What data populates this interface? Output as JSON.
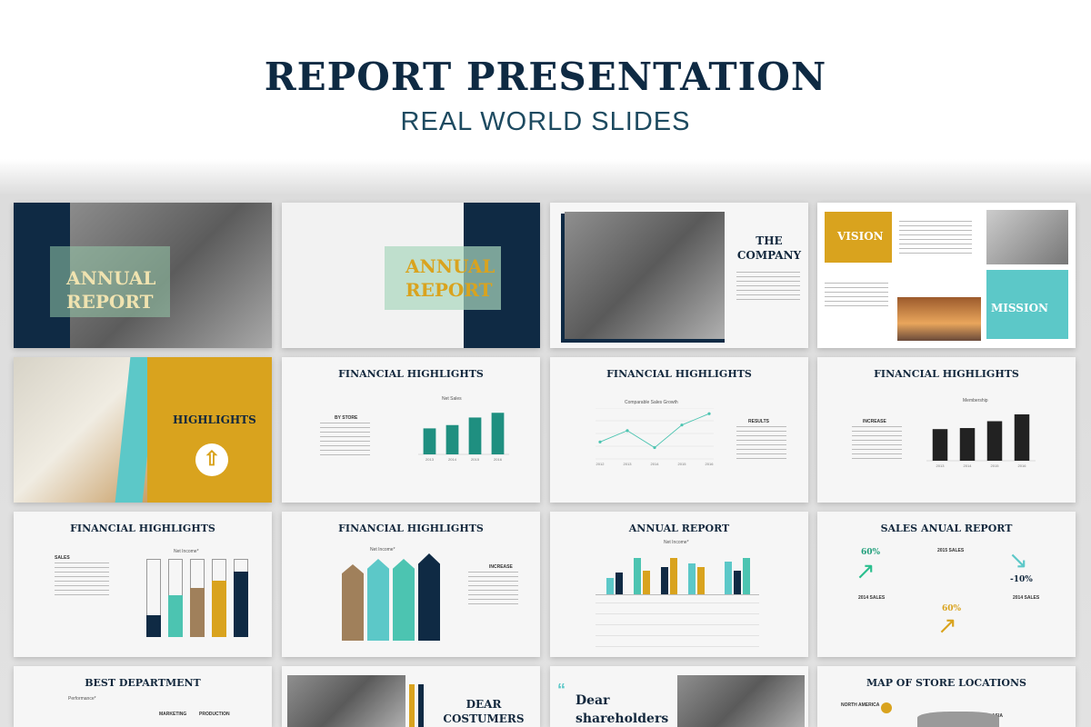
{
  "header": {
    "title": "REPORT PRESENTATION",
    "subtitle": "REAL WORLD SLIDES"
  },
  "slides": {
    "s1": {
      "title_a": "ANNUAL",
      "title_b": "REPORT"
    },
    "s2": {
      "title_a": "ANNUAL",
      "title_b": "REPORT"
    },
    "s3": {
      "title_a": "THE",
      "title_b": "COMPANY"
    },
    "s4": {
      "vision": "VISION",
      "mission": "MISSION"
    },
    "s5": {
      "title": "HIGHLIGHTS"
    },
    "s6": {
      "title": "FINANCIAL HIGHLIGHTS",
      "chart_title": "Net Sales",
      "side": "BY STORE"
    },
    "s7": {
      "title": "FINANCIAL HIGHLIGHTS",
      "chart_title": "Comparable Sales Growth",
      "side": "RESULTS"
    },
    "s8": {
      "title": "FINANCIAL HIGHLIGHTS",
      "chart_title": "Membership",
      "side": "INCREASE"
    },
    "s9": {
      "title": "FINANCIAL HIGHLIGHTS",
      "chart_title": "Net Income*",
      "side": "SALES"
    },
    "s10": {
      "title": "FINANCIAL HIGHLIGHTS",
      "chart_title": "Net Income*",
      "side": "INCREASE"
    },
    "s11": {
      "title": "ANNUAL REPORT",
      "chart_title": "Net Income*"
    },
    "s12": {
      "title": "SALES ANUAL REPORT",
      "p1": "60%",
      "p2": "-10%",
      "p3": "60%",
      "l1": "2015 SALES",
      "l2": "2014 SALES",
      "l3": "2014 SALES"
    },
    "s13": {
      "title": "BEST DEPARTMENT",
      "chart_title": "Performance*",
      "d1": "MARKETING",
      "d2": "PRODUCTION"
    },
    "s14": {
      "title_a": "DEAR",
      "title_b": "COSTUMERS"
    },
    "s15": {
      "title_a": "Dear",
      "title_b": "shareholders"
    },
    "s16": {
      "title": "MAP OF STORE LOCATIONS",
      "r1": "NORTH AMERICA",
      "r2": "ASIA"
    }
  },
  "chart_data": [
    {
      "type": "bar",
      "title": "Net Sales",
      "categories": [
        "2013",
        "2014",
        "2015",
        "2016"
      ],
      "values": [
        55,
        62,
        78,
        88
      ],
      "ylim": [
        0,
        100
      ]
    },
    {
      "type": "line",
      "title": "Comparable Sales Growth",
      "categories": [
        "2012",
        "2013",
        "2014",
        "2015",
        "2016"
      ],
      "values": [
        3,
        5,
        2,
        6,
        8
      ],
      "ylim": [
        0,
        9
      ]
    },
    {
      "type": "bar",
      "title": "Membership",
      "categories": [
        "2013",
        "2014",
        "2015",
        "2016"
      ],
      "values": [
        60,
        62,
        75,
        88
      ],
      "ylim": [
        0,
        100
      ]
    }
  ]
}
